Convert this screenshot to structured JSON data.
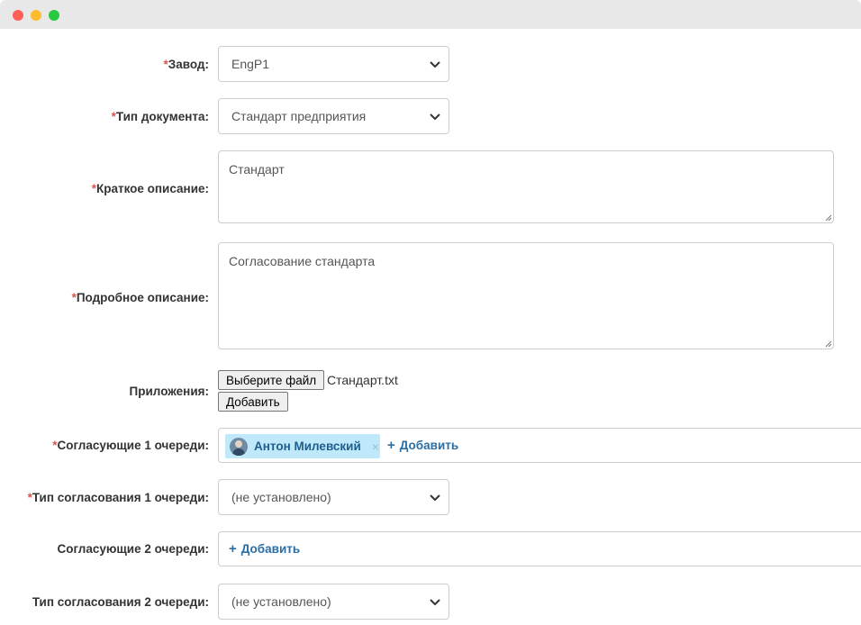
{
  "form": {
    "plant": {
      "label": "Завод:",
      "value": "EngP1"
    },
    "doc_type": {
      "label": "Тип документа:",
      "value": "Стандарт предприятия"
    },
    "short_desc": {
      "label": "Краткое описание:",
      "value": "Стандарт"
    },
    "long_desc": {
      "label": "Подробное описание:",
      "value": "Согласование стандарта"
    },
    "attachments": {
      "label": "Приложения:",
      "choose_label": "Выберите файл",
      "file_name": "Стандарт.txt",
      "add_label": "Добавить"
    },
    "approvers1": {
      "label": "Согласующие 1 очереди:",
      "person": "Антон Милевский",
      "remove": "×",
      "add_label": "Добавить"
    },
    "approval_type1": {
      "label": "Тип согласования 1 очереди:",
      "value": "(не установлено)"
    },
    "approvers2": {
      "label": "Согласующие 2 очереди:",
      "add_label": "Добавить"
    },
    "approval_type2": {
      "label": "Тип согласования 2 очереди:",
      "value": "(не установлено)"
    }
  },
  "required_mark": "*",
  "colors": {
    "required": "#d9534f",
    "link": "#2a6ea6",
    "chip_bg": "#bfe9fb"
  },
  "icons": {
    "dropdown": "chevron-down-icon",
    "add": "plus-icon",
    "remove": "close-icon",
    "resize": "resize-grip-icon"
  }
}
